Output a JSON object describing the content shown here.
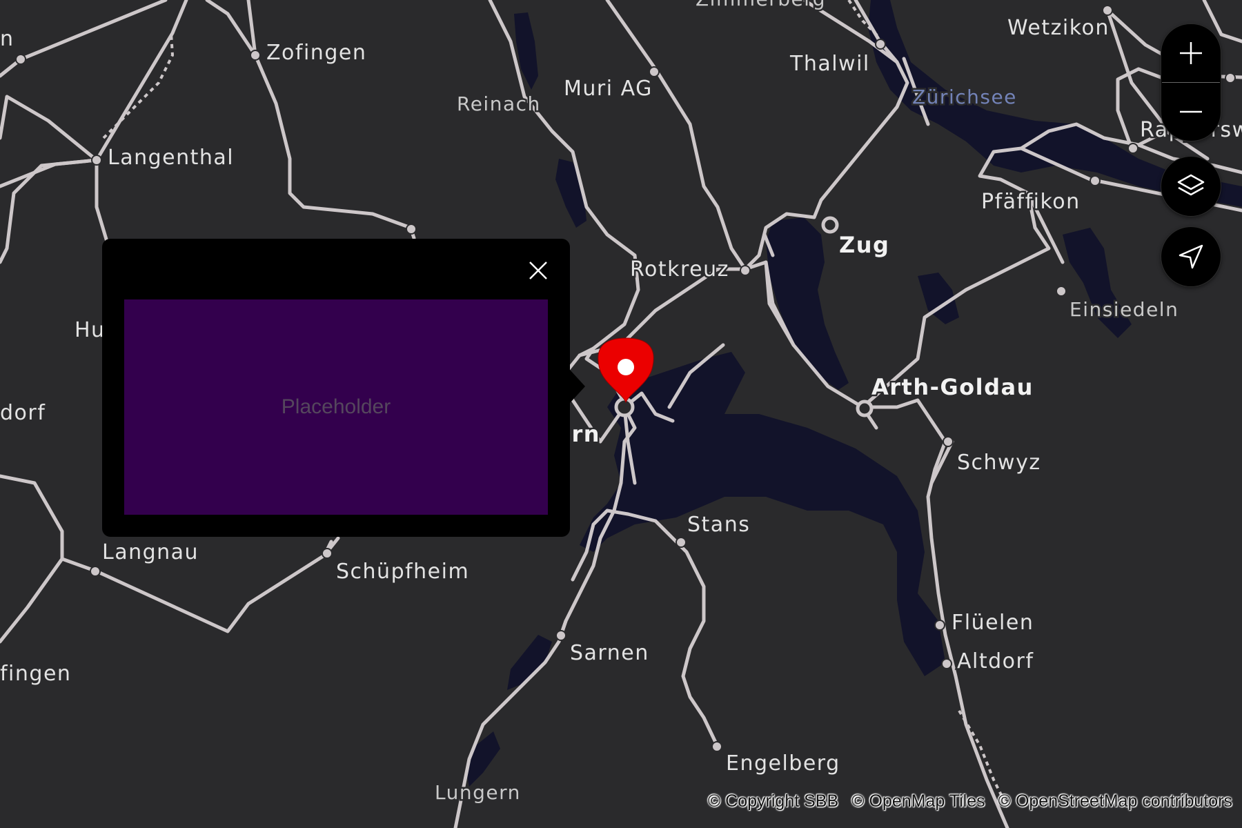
{
  "map": {
    "places": {
      "zimmerberg": "Zimmerberg",
      "wetzikon": "Wetzikon",
      "zofingen": "Zofingen",
      "thalwil": "Thalwil",
      "zurichsee": "Zürichsee",
      "muri": "Muri AG",
      "reinach": "Reinach",
      "langenthal": "Langenthal",
      "pfaffikon": "Pfäffikon",
      "rapperswil": "Rapperswil",
      "zug": "Zug",
      "rotkreuz": "Rotkreuz",
      "einsiedeln": "Einsiedeln",
      "huttwil": "Hu",
      "luzern": "Luzern",
      "arth_goldau": "Arth-Goldau",
      "burgdorf": "dorf",
      "schwyz": "Schwyz",
      "stans": "Stans",
      "langnau": "Langnau",
      "schupfheim": "Schüpfheim",
      "fluelen": "Flüelen",
      "altdorf": "Altdorf",
      "sarnen": "Sarnen",
      "konolfingen": "fingen",
      "engelberg": "Engelberg",
      "lungern": "Lungern",
      "west_edge": "n"
    }
  },
  "controls": {
    "zoom_in_icon": "plus-icon",
    "zoom_out_icon": "minus-icon",
    "layers_icon": "layers-icon",
    "locate_icon": "navigation-arrow-icon"
  },
  "marker": {
    "icon": "map-pin-icon",
    "color": "#eb0000"
  },
  "popup": {
    "close_icon": "close-icon",
    "placeholder": "Placeholder",
    "placeholder_color": "#33004d"
  },
  "attribution": {
    "sbb": "© Copyright SBB",
    "openmaptiles": "© OpenMap Tiles",
    "osm": "© OpenStreetMap contributors"
  }
}
